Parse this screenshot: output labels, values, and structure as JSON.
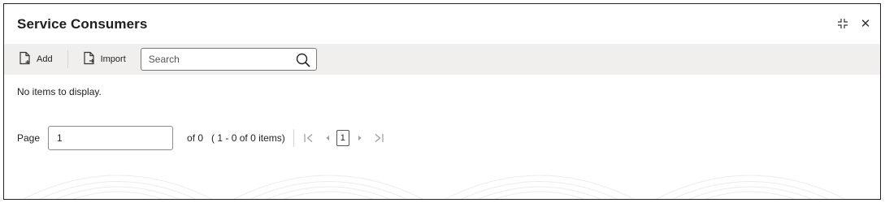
{
  "window": {
    "title": "Service Consumers"
  },
  "controls": {
    "minimize_icon": "collapse-arrows-icon",
    "close_icon": "close-icon",
    "close_glyph": "✕"
  },
  "toolbar": {
    "add_label": "Add",
    "import_label": "Import",
    "search_placeholder": "Search",
    "search_value": ""
  },
  "content": {
    "empty_message": "No items to display."
  },
  "pagination": {
    "page_label": "Page",
    "page_value": "1",
    "of_total": "of 0",
    "range_text": "( 1 - 0 of 0 items)",
    "first_glyph": "|<",
    "prev_glyph": "◂",
    "current_page": "1",
    "next_glyph": "▸",
    "last_glyph": ">|"
  },
  "colors": {
    "toolbar_bg": "#f0efed",
    "border": "#222222",
    "nav_disabled": "#9a9a9a"
  }
}
